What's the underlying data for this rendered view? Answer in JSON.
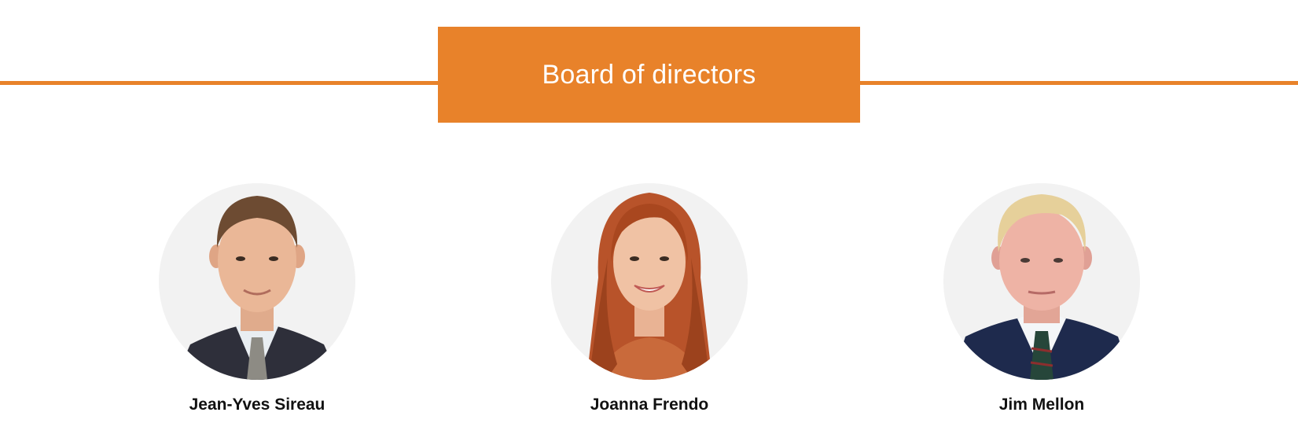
{
  "section": {
    "title": "Board of directors",
    "accent_color": "#E8822A"
  },
  "directors": [
    {
      "name": "Jean-Yves Sireau",
      "photo": "portrait-man-brown-hair-dark-suit-striped-tie"
    },
    {
      "name": "Joanna Frendo",
      "photo": "portrait-woman-long-red-hair"
    },
    {
      "name": "Jim Mellon",
      "photo": "portrait-man-blond-hair-navy-suit-tartan-tie"
    }
  ]
}
